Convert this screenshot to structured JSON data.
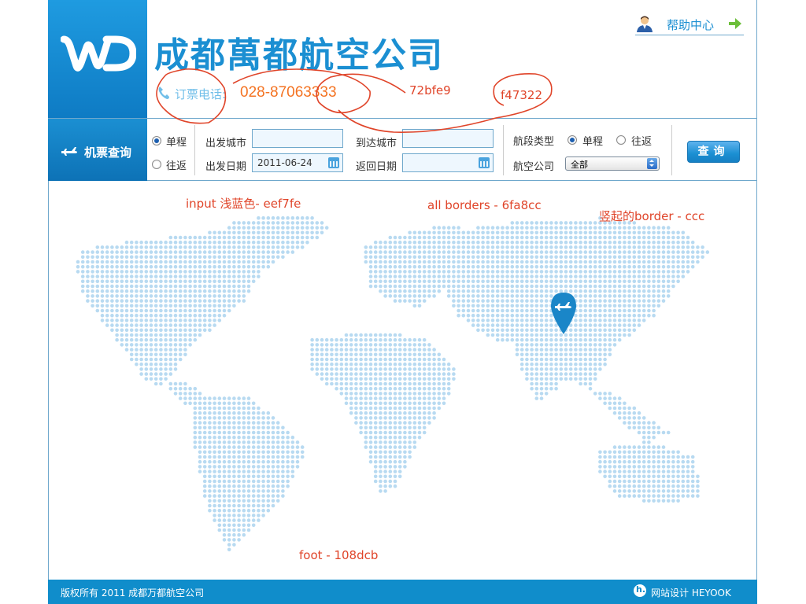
{
  "brand": {
    "company_name": "成都萬都航空公司",
    "phone_label": "订票电话:",
    "phone_number": "028-87063333"
  },
  "header": {
    "help_label": "帮助中心"
  },
  "search": {
    "tab_label": "机票查询",
    "trip_oneway": "单程",
    "trip_return": "往返",
    "depart_city_label": "出发城市",
    "depart_city_value": "",
    "arrive_city_label": "到达城市",
    "arrive_city_value": "",
    "depart_date_label": "出发日期",
    "depart_date_value": "2011-06-24",
    "return_date_label": "返回日期",
    "return_date_value": "",
    "segment_label": "航段类型",
    "segment_oneway": "单程",
    "segment_return": "往返",
    "airline_label": "航空公司",
    "airline_value": "全部",
    "query_button": "查询"
  },
  "annotations": {
    "note_72bfe9": "72bfe9",
    "note_f47322": "f47322",
    "note_input": "input 浅蓝色- eef7fe",
    "note_borders": "all borders - 6fa8cc",
    "note_vertical": "竖起的border - ccc",
    "note_foot": "foot - 108dcb"
  },
  "footer": {
    "copyright": "版权所有 2011   成都万都航空公司",
    "designer": "网站设计 HEYOOK"
  },
  "colors": {
    "brand_blue": "#1b8fd2",
    "phone_label": "#72bfe9",
    "phone_number": "#f47322",
    "input_bg": "#eef7fe",
    "border": "#6fa8cc",
    "vertical_border": "#cccccc",
    "footer": "#108dcb",
    "map_dots": "#b8daf1",
    "annotation": "#e0452a"
  }
}
